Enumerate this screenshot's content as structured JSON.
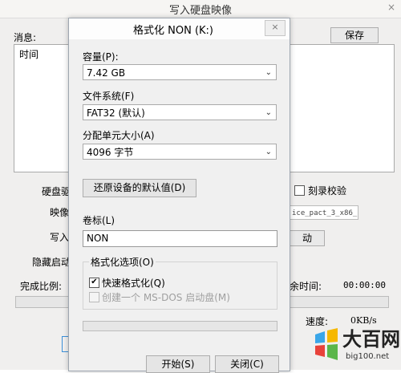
{
  "background_window": {
    "title": "写入硬盘映像",
    "close_label": "×",
    "message_label": "消息:",
    "save_button": "保存",
    "log_column_header": "时间",
    "disk_label": "硬盘驱",
    "image_label": "映像",
    "write_label": "写入",
    "hide_label": "隐藏启动",
    "progress_label": "完成比例:",
    "verify_label": "刻录校验",
    "image_file": "ice_pact_3_x86_",
    "start_fragment": "动",
    "time_label": "余时间:",
    "time_value": "00:00:00",
    "speed_label": "速度:",
    "speed_value": "0KB/s"
  },
  "dialog": {
    "title": "格式化 NON (K:)",
    "close_label": "×",
    "capacity": {
      "label": "容量(P):",
      "value": "7.42 GB"
    },
    "filesystem": {
      "label": "文件系统(F)",
      "value": "FAT32 (默认)"
    },
    "allocation": {
      "label": "分配单元大小(A)",
      "value": "4096 字节"
    },
    "restore_defaults": "还原设备的默认值(D)",
    "volume_label": {
      "label": "卷标(L)",
      "value": "NON"
    },
    "format_options": {
      "title": "格式化选项(O)",
      "quick_format": {
        "label": "快速格式化(Q)",
        "checked": true
      },
      "msdos_boot": {
        "label": "创建一个 MS-DOS 启动盘(M)",
        "checked": false,
        "disabled": true
      }
    },
    "progress": 0,
    "start_button": "开始(S)",
    "close_button": "关闭(C)"
  },
  "watermark": {
    "brand_cn": "大百网",
    "brand_url": "big100.net",
    "colors": [
      "#3aa6e8",
      "#f6b800",
      "#e8423a",
      "#5bb64a"
    ]
  }
}
